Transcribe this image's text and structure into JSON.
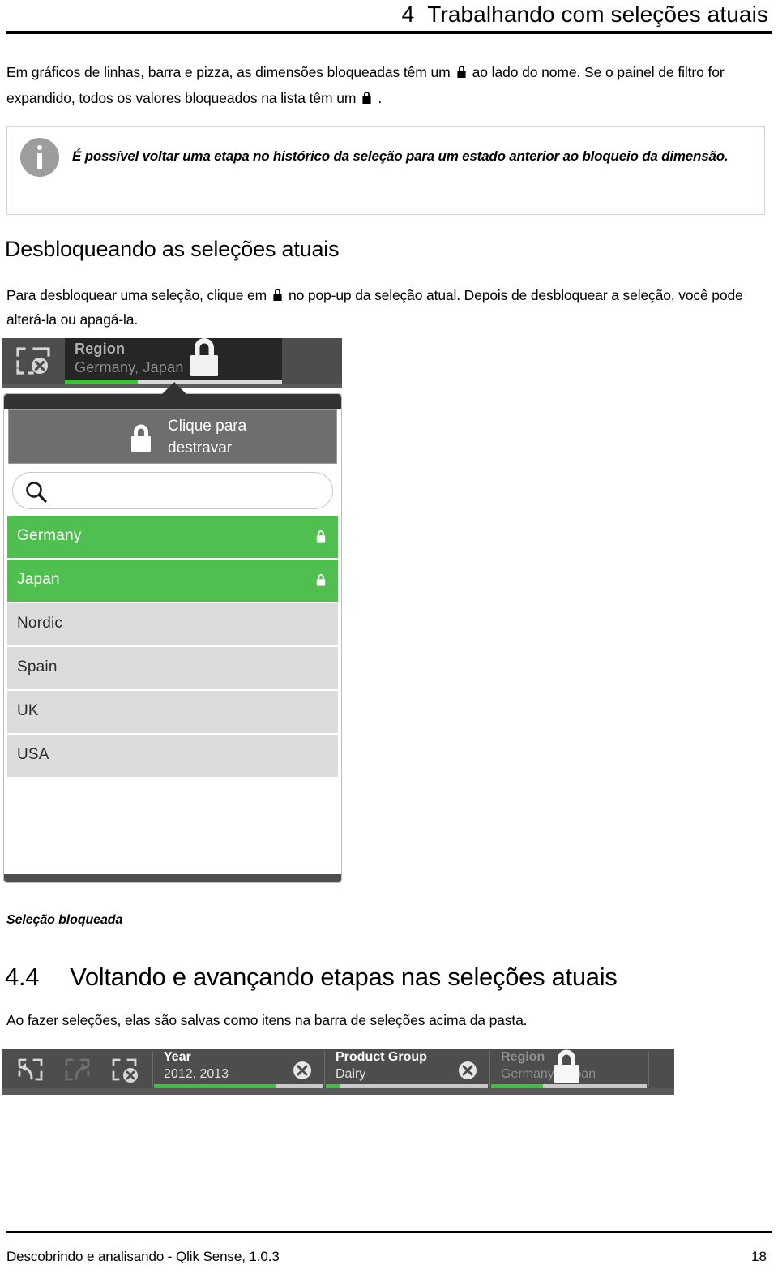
{
  "header": {
    "chapter_number": "4",
    "chapter_title": "Trabalhando com seleções atuais"
  },
  "intro": {
    "part1": "Em gráficos de linhas, barra e pizza, as dimensões bloqueadas têm um",
    "part2": "ao lado do nome. Se o painel de filtro for expandido, todos os valores bloqueados na lista têm um",
    "part3": "."
  },
  "note": {
    "icon": "info-icon",
    "text": "É possível voltar uma etapa no histórico da seleção para um estado anterior ao bloqueio da dimensão."
  },
  "section": {
    "heading": "Desbloqueando as seleções atuais",
    "para_part1": "Para desbloquear uma seleção, clique em",
    "para_part2": "no pop-up da seleção atual. Depois de desbloquear a seleção, você pode alterá-la ou apagá-la."
  },
  "widget": {
    "clear_icon": "clear-selections-icon",
    "tile": {
      "title": "Region",
      "value": "Germany, Japan",
      "lock_icon": "lock-icon",
      "bar_fill_percent": 34
    },
    "popover": {
      "tooltip": {
        "lock_icon": "lock-icon",
        "line1": "Clique para",
        "line2": "destravar"
      },
      "search": {
        "icon": "search-icon",
        "value": "",
        "placeholder": ""
      },
      "list": [
        {
          "label": "Germany",
          "selected": true,
          "locked": true
        },
        {
          "label": "Japan",
          "selected": true,
          "locked": true
        },
        {
          "label": "Nordic",
          "selected": false,
          "locked": false
        },
        {
          "label": "Spain",
          "selected": false,
          "locked": false
        },
        {
          "label": "UK",
          "selected": false,
          "locked": false
        },
        {
          "label": "USA",
          "selected": false,
          "locked": false
        }
      ]
    }
  },
  "figure_caption": "Seleção bloqueada",
  "section44": {
    "number": "4.4",
    "title": "Voltando e avançando etapas nas seleções atuais",
    "para": "Ao fazer seleções, elas são salvas como itens na barra de seleções acima da pasta."
  },
  "bottom_bar": {
    "nav": {
      "step_back_icon": "step-back-icon",
      "step_forward_icon": "step-forward-icon",
      "clear_all_icon": "clear-selections-icon"
    },
    "tiles": [
      {
        "title": "Year",
        "value": "2012, 2013",
        "clear_icon": "clear-icon",
        "locked": false,
        "bar_fill_percent": 72
      },
      {
        "title": "Product Group",
        "value": "Dairy",
        "clear_icon": "clear-icon",
        "locked": false,
        "bar_fill_percent": 9
      },
      {
        "title": "Region",
        "value": "Germany, Japan",
        "clear_icon": "",
        "locked": true,
        "lock_icon": "lock-icon",
        "bar_fill_percent": 34
      }
    ]
  },
  "footer": {
    "left": "Descobrindo e analisando - Qlik Sense, 1.0.3",
    "page": "18"
  },
  "colors": {
    "selected_green": "#4fbf4f",
    "bar_green": "#3cc23c",
    "tile_dark": "#262626",
    "bar_gray": "#4d4d4d",
    "tooltip_gray": "#6e6e6e"
  }
}
